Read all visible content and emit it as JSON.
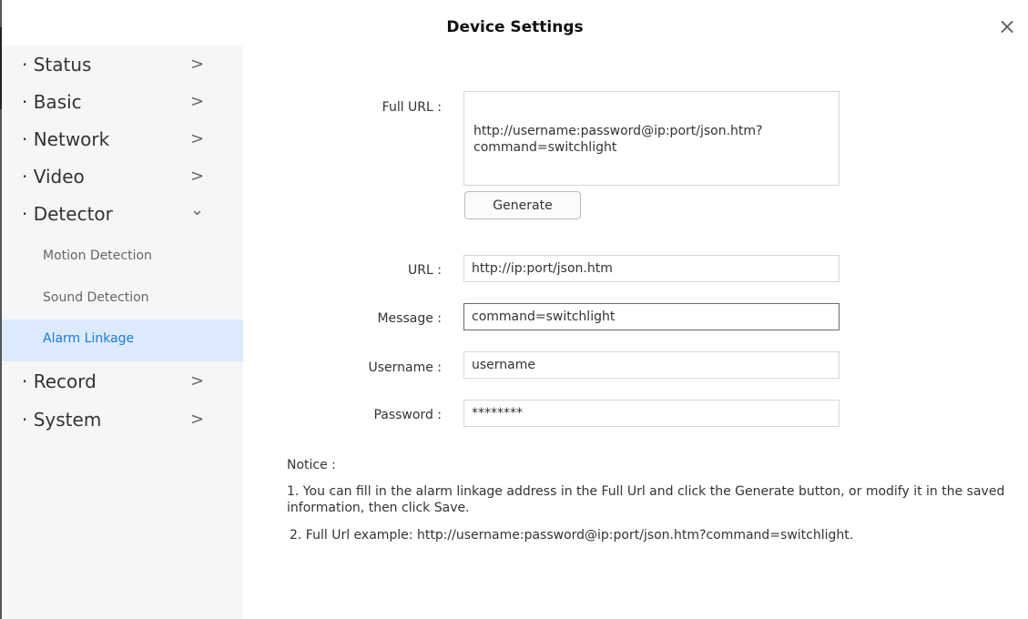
{
  "window": {
    "title": "Device Settings",
    "close_glyph": "×"
  },
  "sidebar": {
    "items": [
      {
        "label": "· Status",
        "chevron": ">"
      },
      {
        "label": "· Basic",
        "chevron": ">"
      },
      {
        "label": "· Network",
        "chevron": ">"
      },
      {
        "label": "· Video",
        "chevron": ">"
      },
      {
        "label": "· Detector",
        "chevron": "⌄"
      },
      {
        "label": "· Record",
        "chevron": ">"
      },
      {
        "label": "· System",
        "chevron": ">"
      }
    ],
    "sub_items": [
      {
        "label": "Motion Detection"
      },
      {
        "label": "Sound Detection"
      },
      {
        "label": "Alarm Linkage",
        "active": true
      }
    ]
  },
  "form": {
    "full_url": {
      "label": "Full URL :",
      "value": "http://username:password@ip:port/json.htm?\ncommand=switchlight"
    },
    "generate_button": "Generate",
    "url": {
      "label": "URL :",
      "value": "http://ip:port/json.htm"
    },
    "message": {
      "label": "Message :",
      "value": "command=switchlight"
    },
    "username": {
      "label": "Username :",
      "value": "username"
    },
    "password": {
      "label": "Password :",
      "value": "********"
    }
  },
  "notice": {
    "title": "Notice :",
    "line1": "1. You can fill in the alarm linkage address in the Full Url and click the Generate button, or modify it in the saved information, then click Save.",
    "line2": "2. Full Url example: http://username:password@ip:port/json.htm?command=switchlight."
  }
}
